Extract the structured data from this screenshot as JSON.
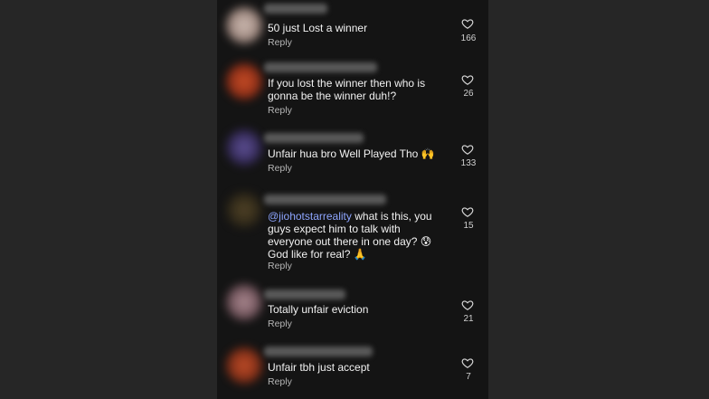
{
  "comments": [
    {
      "text": "50 just Lost a winner",
      "reply": "Reply",
      "likes": "166",
      "avatar_color": "#b9a7a0"
    },
    {
      "text": "If you lost the winner then who is gonna be the winner duh!?",
      "reply": "Reply",
      "likes": "26",
      "avatar_color": "#c8421f"
    },
    {
      "text": "Unfair hua bro Well Played Tho 🙌",
      "reply": "Reply",
      "likes": "133",
      "avatar_color": "#4a3c7a"
    },
    {
      "mention": "@jiohotstarreality",
      "text": " what is this, you guys expect him to talk with everyone out there in one day? 😰 God like for real? 🙏",
      "reply": "Reply",
      "likes": "15",
      "avatar_color": "#3b3320"
    },
    {
      "text": "Totally unfair eviction",
      "reply": "Reply",
      "likes": "21",
      "avatar_color": "#8f6c74"
    },
    {
      "text": "Unfair tbh just accept",
      "reply": "Reply",
      "likes": "7",
      "avatar_color": "#a84124"
    }
  ],
  "icons": {
    "like": "heart-outline-icon"
  }
}
